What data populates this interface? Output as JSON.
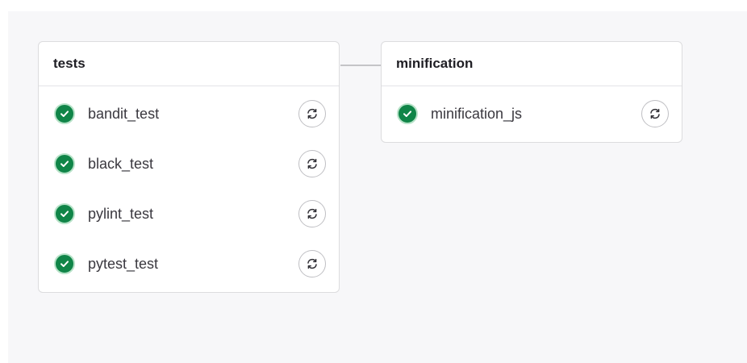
{
  "pipeline": {
    "stages": [
      {
        "title": "tests",
        "jobs": [
          {
            "name": "bandit_test",
            "status": "passed",
            "action_icon": "retry-icon"
          },
          {
            "name": "black_test",
            "status": "passed",
            "action_icon": "retry-icon"
          },
          {
            "name": "pylint_test",
            "status": "passed",
            "action_icon": "retry-icon"
          },
          {
            "name": "pytest_test",
            "status": "passed",
            "action_icon": "retry-icon"
          }
        ]
      },
      {
        "title": "minification",
        "jobs": [
          {
            "name": "minification_js",
            "status": "passed",
            "action_icon": "retry-icon"
          }
        ]
      }
    ]
  },
  "colors": {
    "success": "#108548",
    "canvas": "#f7f7f9",
    "border": "#dcdcde"
  }
}
